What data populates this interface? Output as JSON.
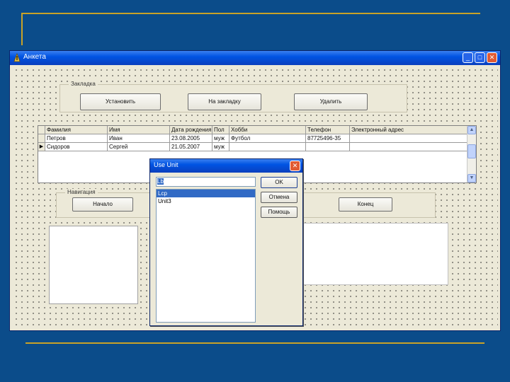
{
  "window": {
    "title": "Анкета",
    "minimize": "_",
    "maximize": "□",
    "close": "✕"
  },
  "bookmarks": {
    "group_label": "Закладка",
    "set_label": "Установить",
    "goto_label": "На закладку",
    "delete_label": "Удалить"
  },
  "grid": {
    "columns": [
      "Фамилия",
      "Имя",
      "Дата рождения",
      "Пол",
      "Хобби",
      "Телефон",
      "Электронный адрес"
    ],
    "rows": [
      [
        "Петров",
        "Иван",
        "23.08.2005",
        "муж",
        "Футбол",
        "87725496-35",
        ""
      ],
      [
        "Сидоров",
        "Сергей",
        "21.05.2007",
        "муж",
        "",
        "",
        ""
      ]
    ],
    "current_row_marker": "▶"
  },
  "navigation": {
    "group_label": "Навигация",
    "start_label": "Начало",
    "end_label": "Конец"
  },
  "dialog": {
    "title": "Use Unit",
    "close": "✕",
    "input_value": "Lb",
    "units": [
      "Lcp",
      "Unit3"
    ],
    "selected_index": 0,
    "ok_label": "OK",
    "cancel_label": "Отмена",
    "help_label": "Помощь"
  },
  "colors": {
    "slide_background": "#0b4c8a",
    "slide_accent": "#c9a227",
    "titlebar": "#0054e3",
    "form_background": "#ece9d8",
    "selection": "#316ac5"
  }
}
